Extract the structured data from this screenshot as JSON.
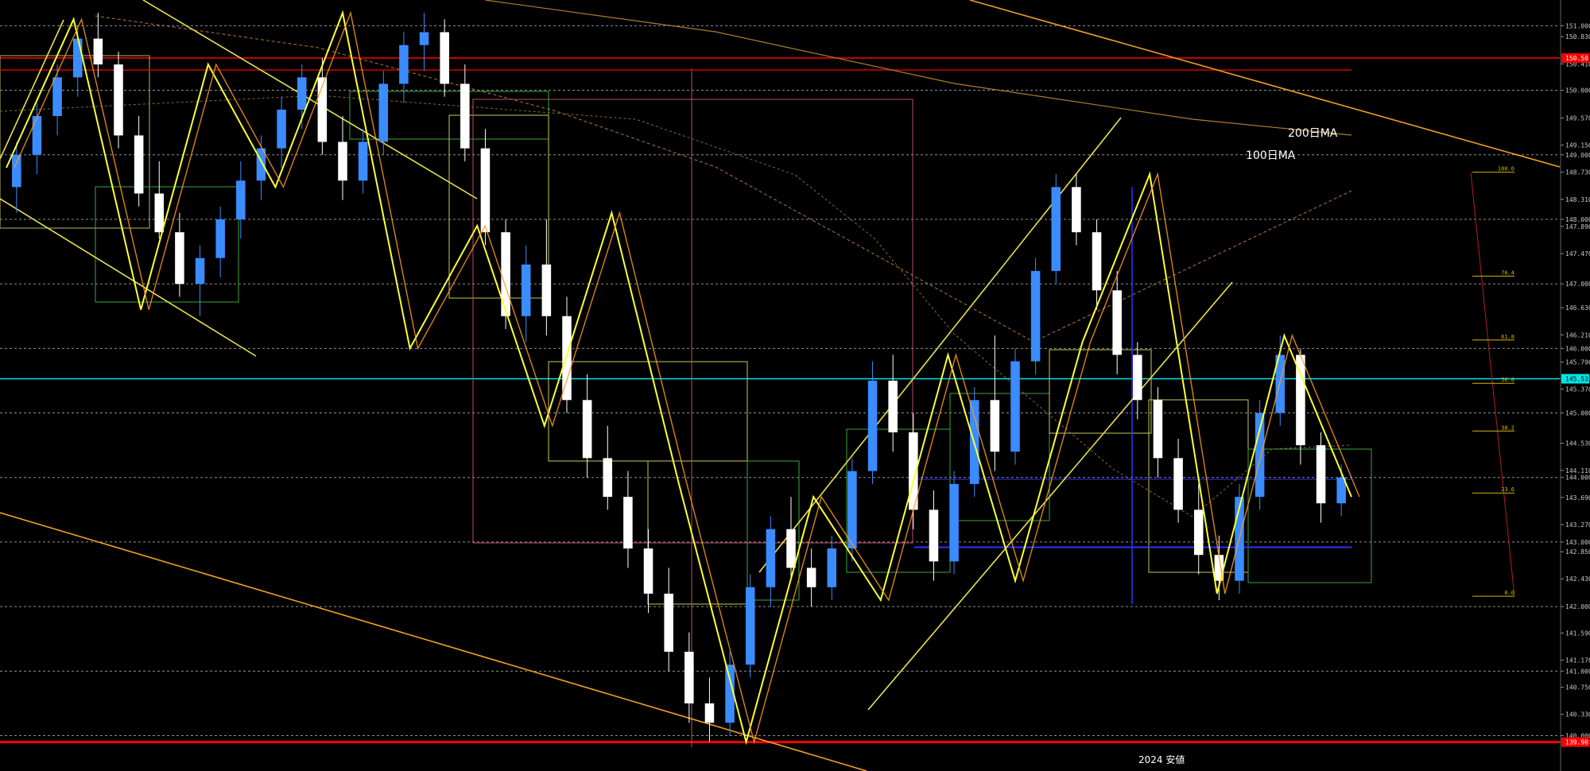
{
  "chart": {
    "labels": {
      "ma200": "200日MA",
      "ma100": "100日MA",
      "period": "2024 安値"
    }
  },
  "chart_data": {
    "type": "candlestick",
    "instrument_note": "",
    "ylim": [
      139.6,
      151.3
    ],
    "y_ticks": [
      151.0,
      150.83,
      150.41,
      150.0,
      149.57,
      149.15,
      149.0,
      148.73,
      148.31,
      148.0,
      147.89,
      147.47,
      147.0,
      146.63,
      146.21,
      146.0,
      145.79,
      145.53,
      145.37,
      145.0,
      144.53,
      144.11,
      144.0,
      143.69,
      143.27,
      143.0,
      142.85,
      142.43,
      142.0,
      141.59,
      141.17,
      141.0,
      140.75,
      140.33,
      140.0,
      139.9
    ],
    "highlighted_levels": [
      {
        "value": 150.5,
        "label": "150.50",
        "color": "#ff0000"
      },
      {
        "value": 145.53,
        "label": "145.533",
        "color": "#00e5e5"
      },
      {
        "value": 139.9,
        "label": "139.90",
        "color": "#ff0000"
      }
    ],
    "horizontal_lines": [
      {
        "value": 151.0,
        "style": "dashed",
        "color": "#909090"
      },
      {
        "value": 150.0,
        "style": "dashed",
        "color": "#909090"
      },
      {
        "value": 149.0,
        "style": "dashed",
        "color": "#909090"
      },
      {
        "value": 148.0,
        "style": "dashed",
        "color": "#909090"
      },
      {
        "value": 147.0,
        "style": "dashed",
        "color": "#909090"
      },
      {
        "value": 146.0,
        "style": "dashed",
        "color": "#909090"
      },
      {
        "value": 145.0,
        "style": "dashed",
        "color": "#909090"
      },
      {
        "value": 144.0,
        "style": "dashed",
        "color": "#909090"
      },
      {
        "value": 143.0,
        "style": "dashed",
        "color": "#909090"
      },
      {
        "value": 142.0,
        "style": "dashed",
        "color": "#909090"
      },
      {
        "value": 141.0,
        "style": "dashed",
        "color": "#909090"
      },
      {
        "value": 140.0,
        "style": "dashed",
        "color": "#909090"
      }
    ],
    "fibonacci": {
      "levels": [
        {
          "ratio": "100.0",
          "value": 148.73
        },
        {
          "ratio": "76.4",
          "value": 147.12
        },
        {
          "ratio": "61.8",
          "value": 146.13
        },
        {
          "ratio": "50.0",
          "value": 145.46
        },
        {
          "ratio": "38.2",
          "value": 144.72
        },
        {
          "ratio": "23.6",
          "value": 143.76
        },
        {
          "ratio": "0.0",
          "value": 142.16
        }
      ]
    },
    "zigzag": [
      148.8,
      151.1,
      146.6,
      150.4,
      148.5,
      151.2,
      146.0,
      147.9,
      144.8,
      148.1,
      143.9,
      139.9,
      143.7,
      142.1,
      145.9,
      142.4,
      146.1,
      148.7,
      142.2,
      146.2,
      143.7
    ],
    "candles": [
      [
        148.5,
        149.2,
        148.1,
        149.0
      ],
      [
        149.0,
        149.8,
        148.7,
        149.6
      ],
      [
        149.6,
        150.4,
        149.3,
        150.2
      ],
      [
        150.2,
        151.0,
        149.9,
        150.8
      ],
      [
        150.8,
        151.2,
        150.2,
        150.4
      ],
      [
        150.4,
        150.6,
        149.1,
        149.3
      ],
      [
        149.3,
        149.6,
        148.2,
        148.4
      ],
      [
        148.4,
        148.9,
        147.7,
        147.8
      ],
      [
        147.8,
        148.1,
        146.8,
        147.0
      ],
      [
        147.0,
        147.6,
        146.5,
        147.4
      ],
      [
        147.4,
        148.2,
        147.1,
        148.0
      ],
      [
        148.0,
        148.9,
        147.7,
        148.6
      ],
      [
        148.6,
        149.3,
        148.3,
        149.1
      ],
      [
        149.1,
        149.9,
        148.8,
        149.7
      ],
      [
        149.7,
        150.4,
        149.4,
        150.2
      ],
      [
        150.2,
        150.5,
        149.0,
        149.2
      ],
      [
        149.2,
        149.6,
        148.3,
        148.6
      ],
      [
        148.6,
        149.4,
        148.4,
        149.2
      ],
      [
        149.2,
        150.3,
        149.0,
        150.1
      ],
      [
        150.1,
        150.9,
        149.8,
        150.7
      ],
      [
        150.7,
        151.2,
        150.3,
        150.9
      ],
      [
        150.9,
        151.1,
        149.9,
        150.1
      ],
      [
        150.1,
        150.4,
        148.9,
        149.1
      ],
      [
        149.1,
        149.4,
        147.6,
        147.8
      ],
      [
        147.8,
        148.0,
        146.3,
        146.5
      ],
      [
        146.5,
        147.6,
        146.1,
        147.3
      ],
      [
        147.3,
        148.0,
        146.2,
        146.5
      ],
      [
        146.5,
        146.8,
        145.0,
        145.2
      ],
      [
        145.2,
        145.6,
        144.0,
        144.3
      ],
      [
        144.3,
        144.8,
        143.5,
        143.7
      ],
      [
        143.7,
        144.1,
        142.6,
        142.9
      ],
      [
        142.9,
        143.2,
        141.9,
        142.2
      ],
      [
        142.2,
        142.6,
        141.0,
        141.3
      ],
      [
        141.3,
        141.6,
        140.2,
        140.5
      ],
      [
        140.5,
        140.9,
        139.9,
        140.2
      ],
      [
        140.2,
        141.3,
        140.0,
        141.1
      ],
      [
        141.1,
        142.5,
        140.9,
        142.3
      ],
      [
        142.3,
        143.4,
        142.0,
        143.2
      ],
      [
        143.2,
        143.7,
        142.4,
        142.6
      ],
      [
        142.6,
        142.9,
        142.0,
        142.3
      ],
      [
        142.3,
        143.1,
        142.1,
        142.9
      ],
      [
        142.9,
        144.3,
        142.7,
        144.1
      ],
      [
        144.1,
        145.8,
        143.9,
        145.5
      ],
      [
        145.5,
        145.9,
        144.4,
        144.7
      ],
      [
        144.7,
        145.0,
        143.2,
        143.5
      ],
      [
        143.5,
        143.8,
        142.4,
        142.7
      ],
      [
        142.7,
        144.1,
        142.5,
        143.9
      ],
      [
        143.9,
        145.4,
        143.7,
        145.2
      ],
      [
        145.2,
        146.2,
        144.1,
        144.4
      ],
      [
        144.4,
        146.0,
        144.2,
        145.8
      ],
      [
        145.8,
        147.4,
        145.6,
        147.2
      ],
      [
        147.2,
        148.7,
        147.0,
        148.5
      ],
      [
        148.5,
        148.7,
        147.6,
        147.8
      ],
      [
        147.8,
        148.0,
        146.6,
        146.9
      ],
      [
        146.9,
        147.2,
        145.6,
        145.9
      ],
      [
        145.9,
        146.1,
        144.9,
        145.2
      ],
      [
        145.2,
        145.4,
        144.0,
        144.3
      ],
      [
        144.3,
        144.6,
        143.3,
        143.5
      ],
      [
        143.5,
        143.9,
        142.5,
        142.8
      ],
      [
        142.8,
        143.1,
        142.1,
        142.4
      ],
      [
        142.4,
        143.9,
        142.2,
        143.7
      ],
      [
        143.7,
        145.2,
        143.5,
        145.0
      ],
      [
        145.0,
        146.2,
        144.8,
        145.9
      ],
      [
        145.9,
        146.0,
        144.2,
        144.5
      ],
      [
        144.5,
        144.7,
        143.3,
        143.6
      ],
      [
        143.6,
        144.2,
        143.4,
        144.0
      ]
    ]
  }
}
